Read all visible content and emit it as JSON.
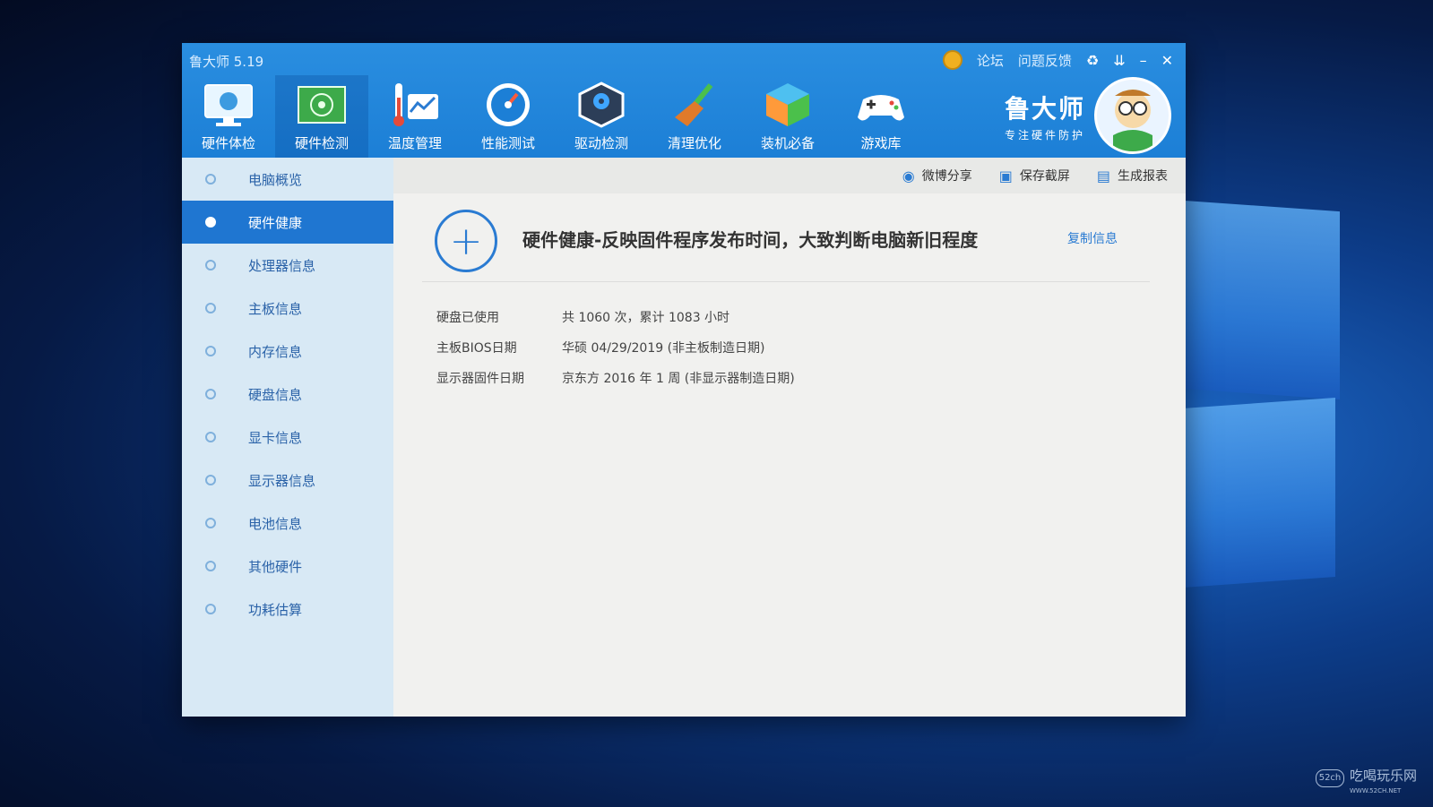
{
  "window": {
    "title": "鲁大师 5.19"
  },
  "top_controls": {
    "forum": "论坛",
    "feedback": "问题反馈"
  },
  "nav": [
    {
      "label": "硬件体检",
      "icon": "monitor-icon"
    },
    {
      "label": "硬件检测",
      "icon": "circuit-board-icon",
      "active": true
    },
    {
      "label": "温度管理",
      "icon": "thermometer-icon"
    },
    {
      "label": "性能测试",
      "icon": "speedometer-icon"
    },
    {
      "label": "驱动检测",
      "icon": "gear-box-icon"
    },
    {
      "label": "清理优化",
      "icon": "broom-icon"
    },
    {
      "label": "装机必备",
      "icon": "cube-icon"
    },
    {
      "label": "游戏库",
      "icon": "gamepad-icon"
    }
  ],
  "brand": {
    "name": "鲁大师",
    "slogan": "专注硬件防护"
  },
  "sidebar": [
    {
      "label": "电脑概览"
    },
    {
      "label": "硬件健康",
      "active": true
    },
    {
      "label": "处理器信息"
    },
    {
      "label": "主板信息"
    },
    {
      "label": "内存信息"
    },
    {
      "label": "硬盘信息"
    },
    {
      "label": "显卡信息"
    },
    {
      "label": "显示器信息"
    },
    {
      "label": "电池信息"
    },
    {
      "label": "其他硬件"
    },
    {
      "label": "功耗估算"
    }
  ],
  "toolbar": {
    "share": "微博分享",
    "screenshot": "保存截屏",
    "report": "生成报表"
  },
  "main": {
    "heading": "硬件健康-反映固件程序发布时间，大致判断电脑新旧程度",
    "copy": "复制信息",
    "rows": [
      {
        "key": "硬盘已使用",
        "value": "共 1060 次，累计 1083 小时"
      },
      {
        "key": "主板BIOS日期",
        "value": "华硕 04/29/2019 (非主板制造日期)"
      },
      {
        "key": "显示器固件日期",
        "value": "京东方 2016 年 1 周 (非显示器制造日期)"
      }
    ]
  },
  "watermark": {
    "text": "吃喝玩乐网",
    "url": "WWW.52CH.NET",
    "badge": "52ch"
  }
}
